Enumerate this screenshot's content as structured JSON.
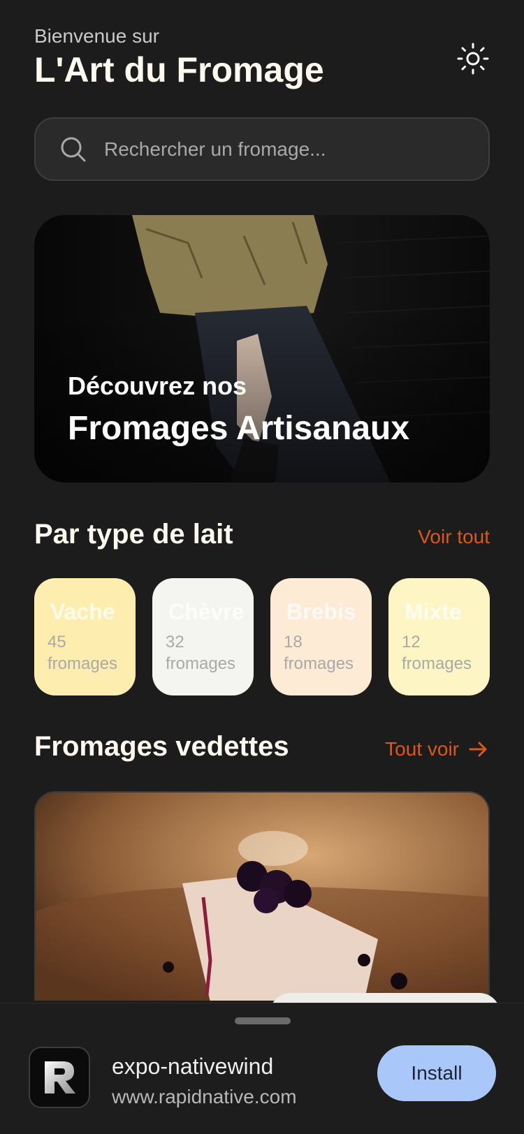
{
  "header": {
    "welcome": "Bienvenue sur",
    "title": "L'Art du Fromage",
    "theme_icon": "sun-icon"
  },
  "search": {
    "placeholder": "Rechercher un fromage...",
    "icon": "search-icon"
  },
  "hero": {
    "subtitle": "Découvrez nos",
    "title": "Fromages Artisanaux"
  },
  "milk_section": {
    "title": "Par type de lait",
    "link": "Voir tout",
    "items": [
      {
        "name": "Vache",
        "count": "45 fromages",
        "color": "#fdeeb0"
      },
      {
        "name": "Chèvre",
        "count": "32 fromages",
        "color": "#f4f4f1"
      },
      {
        "name": "Brebis",
        "count": "18 fromages",
        "color": "#feebd6"
      },
      {
        "name": "Mixte",
        "count": "12 fromages",
        "color": "#fdf5c3"
      }
    ]
  },
  "featured_section": {
    "title": "Fromages vedettes",
    "link": "Tout voir",
    "link_icon": "arrow-right-icon"
  },
  "install_banner": {
    "app_name": "expo-nativewind",
    "url": "www.rapidnative.com",
    "button": "Install"
  },
  "colors": {
    "background": "#1c1c1c",
    "accent": "#d9581c",
    "install_button": "#a9c8f9"
  }
}
